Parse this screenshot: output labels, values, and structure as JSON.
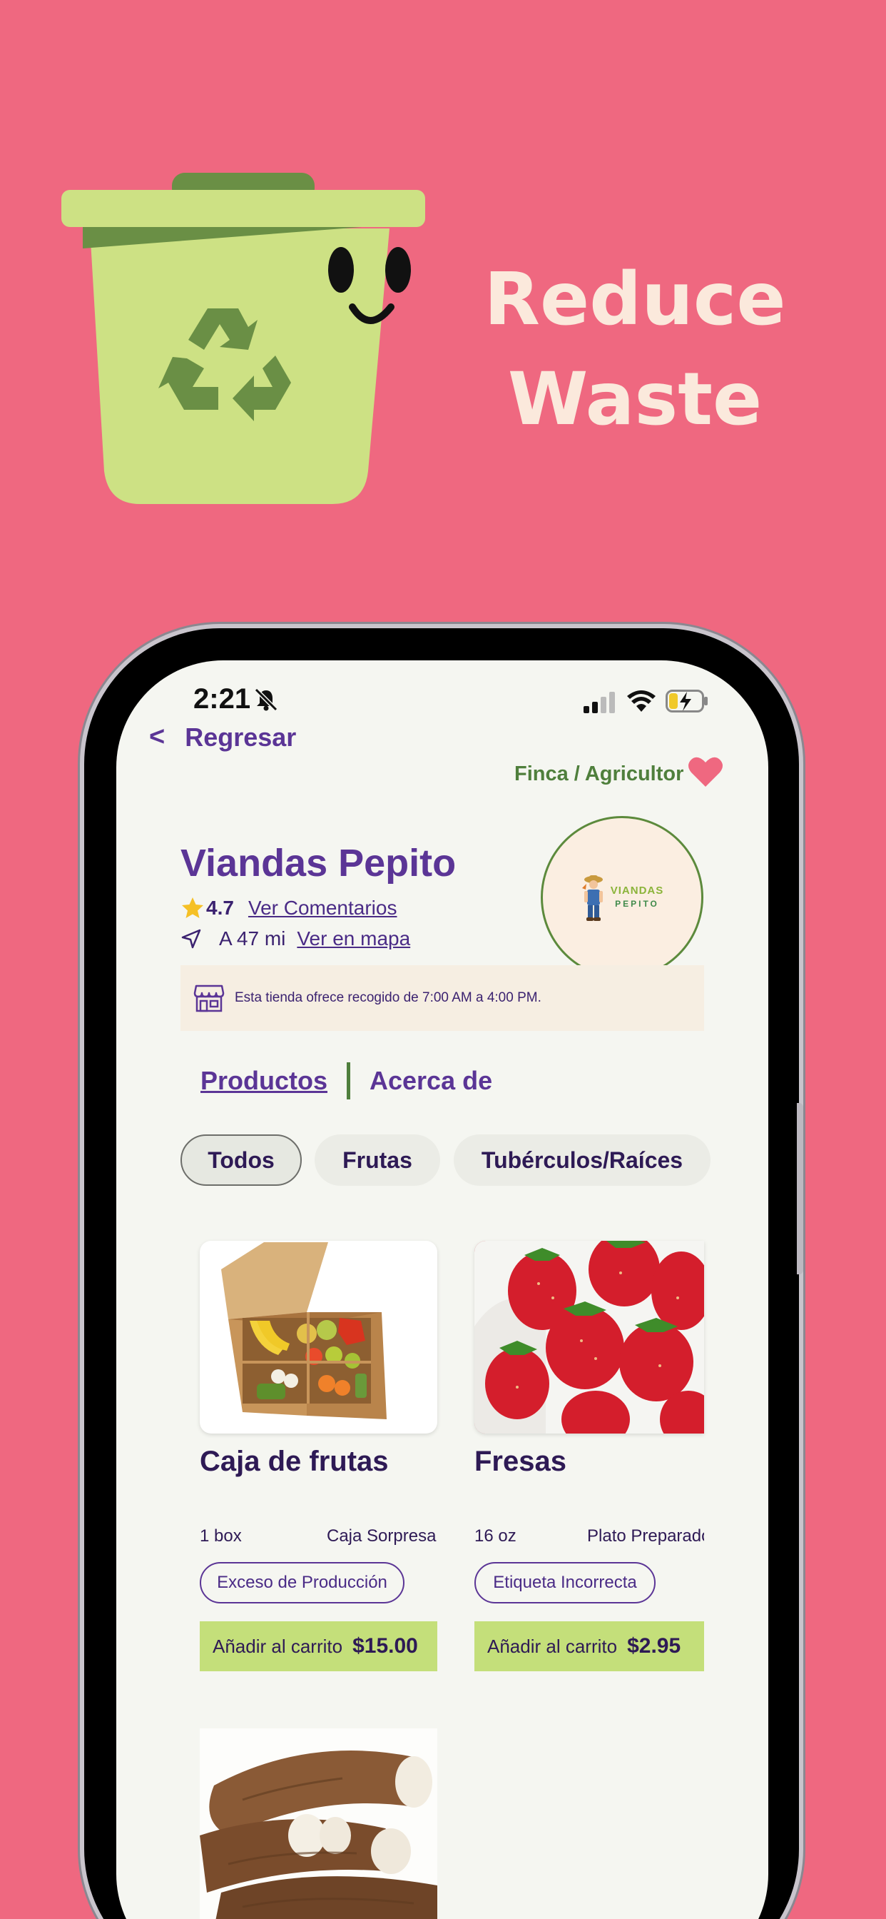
{
  "hero": {
    "title_line1": "Reduce",
    "title_line2": "Waste"
  },
  "status_bar": {
    "time": "2:21"
  },
  "nav": {
    "back_label": "Regresar",
    "back_chevron": "<",
    "store_type": "Finca / Agricultor"
  },
  "store": {
    "name": "Viandas Pepito",
    "rating": "4.7",
    "reviews_link": "Ver Comentarios",
    "distance": "A 47 mi",
    "map_link": "Ver en mapa",
    "logo_line1": "VIANDAS",
    "logo_line2": "PEPITO",
    "pickup_notice": "Esta tienda ofrece recogido de 7:00 AM a 4:00 PM."
  },
  "tabs": {
    "products": "Productos",
    "about": "Acerca de"
  },
  "filters": [
    "Todos",
    "Frutas",
    "Tubérculos/Raíces"
  ],
  "products": [
    {
      "name": "Caja de frutas",
      "qty": "1 box",
      "type": "Caja Sorpresa",
      "tag": "Exceso de Producción",
      "add_label": "Añadir al carrito",
      "price": "$15.00"
    },
    {
      "name": "Fresas",
      "qty": "16 oz",
      "type": "Plato Preparado",
      "tag": "Etiqueta Incorrecta",
      "add_label": "Añadir al carrito",
      "price": "$2.95"
    }
  ],
  "colors": {
    "background": "#ef6880",
    "brand_purple": "#5b3596",
    "accent_green": "#c4df7a",
    "farm_green": "#4f7f3c",
    "heart": "#ef6880"
  },
  "icons": [
    "recycle-bin-icon",
    "bell-slash-icon",
    "signal-icon",
    "wifi-icon",
    "battery-charging-icon",
    "heart-icon",
    "star-icon",
    "navigation-arrow-icon",
    "store-icon"
  ]
}
